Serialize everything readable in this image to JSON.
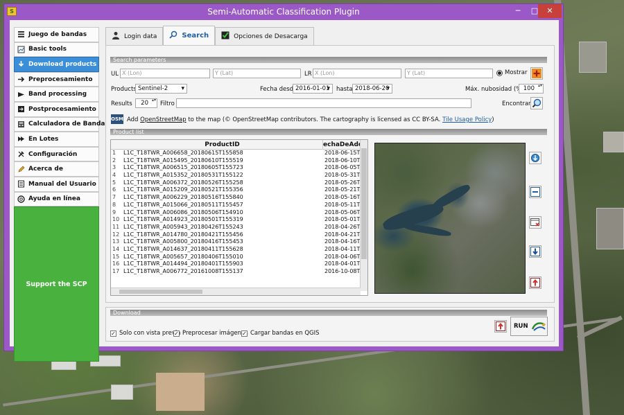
{
  "window": {
    "title": "Semi-Automatic Classification Plugin",
    "icon_text": "S",
    "min_glyph": "─",
    "max_glyph": "□",
    "close_glyph": "✕"
  },
  "sidebar": {
    "items": [
      {
        "label": "Juego de bandas",
        "icon": "band-set-icon"
      },
      {
        "label": "Basic tools",
        "icon": "basic-tools-icon"
      },
      {
        "label": "Download products",
        "icon": "download-icon",
        "active": true
      },
      {
        "label": "Preprocesamiento",
        "icon": "preprocessing-icon"
      },
      {
        "label": "Band processing",
        "icon": "band-processing-icon"
      },
      {
        "label": "Postprocesamiento",
        "icon": "postprocessing-icon"
      },
      {
        "label": "Calculadora de Bandas",
        "icon": "calculator-icon"
      },
      {
        "label": "En Lotes",
        "icon": "batch-icon"
      },
      {
        "label": "Configuración",
        "icon": "settings-icon"
      },
      {
        "label": "Acerca de",
        "icon": "about-icon"
      },
      {
        "label": "Manual del Usuario",
        "icon": "manual-icon"
      },
      {
        "label": "Ayuda en línea",
        "icon": "help-icon"
      }
    ],
    "support_label": "Support the SCP"
  },
  "tabs": [
    {
      "label": "Login data",
      "icon": "user-icon"
    },
    {
      "label": "Search",
      "icon": "search-icon",
      "active": true
    },
    {
      "label": "Opciones de Desacarga",
      "icon": "checkbox-icon"
    }
  ],
  "search": {
    "section_title": "Search parameters",
    "ul_label": "UL",
    "lr_label": "LR",
    "ul_x_placeholder": "X (Lon)",
    "ul_y_placeholder": "Y (Lat)",
    "lr_x_placeholder": "X (Lon)",
    "lr_y_placeholder": "Y (Lat)",
    "show_label": "Mostrar",
    "products_label": "Products",
    "products_value": "Sentinel-2",
    "date_from_label": "Fecha desde",
    "date_from_value": "2016-01-01",
    "date_to_label": "hasta",
    "date_to_value": "2018-06-20",
    "cloud_label": "Máx. nubosidad (%)",
    "cloud_value": "100",
    "results_label": "Results",
    "results_value": "20",
    "filter_label": "Filtro",
    "filter_value": "",
    "find_label": "Encontrar",
    "osm_badge": "OSM",
    "osm_add": "Add",
    "osm_link": "OpenStreetMap",
    "osm_to_map": "to the map",
    "osm_attrib": "(© OpenStreetMap contributors. The cartography is licensed as CC BY-SA.",
    "osm_policy": "Tile Usage Policy",
    "osm_close": ")"
  },
  "product_list": {
    "section_title": "Product list",
    "columns": [
      "ProductID",
      "echaDeAdqui"
    ],
    "rows": [
      {
        "n": "1",
        "id": "L1C_T18TWR_A006658_20180615T155858",
        "date": "2018-06-15T1"
      },
      {
        "n": "2",
        "id": "L1C_T18TWR_A015495_20180610T155519",
        "date": "2018-06-10T1"
      },
      {
        "n": "3",
        "id": "L1C_T18TWR_A006515_20180605T155723",
        "date": "2018-06-05T1"
      },
      {
        "n": "4",
        "id": "L1C_T18TWR_A015352_20180531T155122",
        "date": "2018-05-31T1"
      },
      {
        "n": "5",
        "id": "L1C_T18TWR_A006372_20180526T155258",
        "date": "2018-05-26T1"
      },
      {
        "n": "6",
        "id": "L1C_T18TWR_A015209_20180521T155356",
        "date": "2018-05-21T1"
      },
      {
        "n": "7",
        "id": "L1C_T18TWR_A006229_20180516T155840",
        "date": "2018-05-16T1"
      },
      {
        "n": "8",
        "id": "L1C_T18TWR_A015066_20180511T155457",
        "date": "2018-05-11T1"
      },
      {
        "n": "9",
        "id": "L1C_T18TWR_A006086_20180506T154910",
        "date": "2018-05-06T1"
      },
      {
        "n": "10",
        "id": "L1C_T18TWR_A014923_20180501T155319",
        "date": "2018-05-01T1"
      },
      {
        "n": "11",
        "id": "L1C_T18TWR_A005943_20180426T155243",
        "date": "2018-04-26T1"
      },
      {
        "n": "12",
        "id": "L1C_T18TWR_A014780_20180421T155456",
        "date": "2018-04-21T1"
      },
      {
        "n": "13",
        "id": "L1C_T18TWR_A005800_20180416T155453",
        "date": "2018-04-16T1"
      },
      {
        "n": "14",
        "id": "L1C_T18TWR_A014637_20180411T155628",
        "date": "2018-04-11T1"
      },
      {
        "n": "15",
        "id": "L1C_T18TWR_A005657_20180406T155010",
        "date": "2018-04-06T1"
      },
      {
        "n": "16",
        "id": "L1C_T18TWR_A014494_20180401T155903",
        "date": "2018-04-01T1"
      },
      {
        "n": "17",
        "id": "L1C_T18TWR_A006772_20161008T155137",
        "date": "2016-10-08T1"
      }
    ]
  },
  "download": {
    "section_title": "Download",
    "only_preview": "Solo con vista previa",
    "preprocess": "Preprocesar imágenes",
    "load_bands": "Cargar bandas en QGIS",
    "run_label": "RUN",
    "check_glyph": "✓"
  },
  "colors": {
    "accent": "#3b8fd9",
    "support": "#49b23f",
    "window": "#9b59c7"
  }
}
